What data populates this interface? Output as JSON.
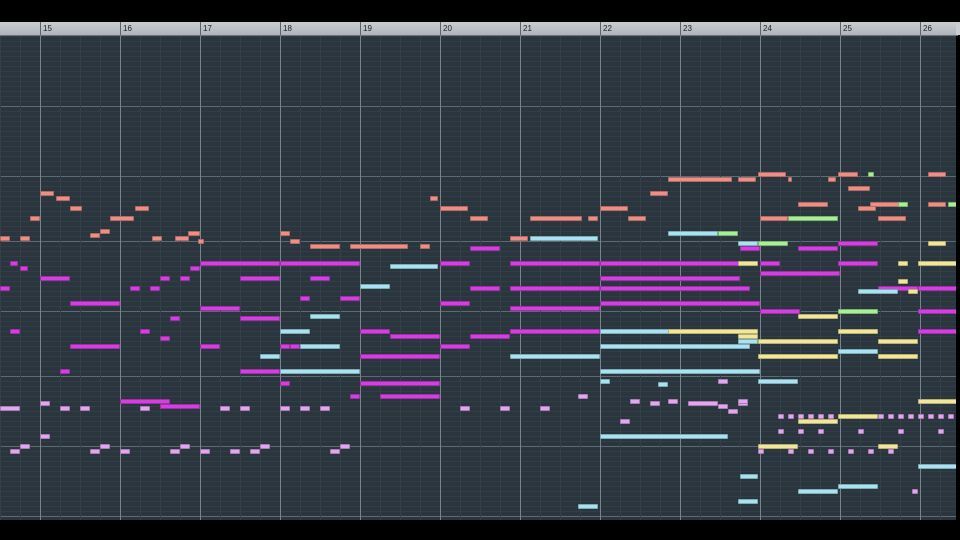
{
  "window": {
    "title": ""
  },
  "ruler": {
    "bars": [
      "15",
      "16",
      "17",
      "18",
      "19",
      "20",
      "21",
      "22",
      "23",
      "24",
      "25",
      "26"
    ]
  },
  "colors": {
    "background": "#2b353d",
    "grid_line": "#323e47",
    "octave_line": "#5d6b75",
    "bar_line": "#76848e",
    "track_salmon": "#ee8f86",
    "track_magenta": "#d43fe0",
    "track_cyan": "#a9e3f2",
    "track_lavender": "#e3a6f0",
    "track_yellow": "#f1e79b",
    "track_green": "#a9ef95"
  },
  "piano_roll": {
    "view": "piano-roll",
    "note_count_visible": "many"
  }
}
